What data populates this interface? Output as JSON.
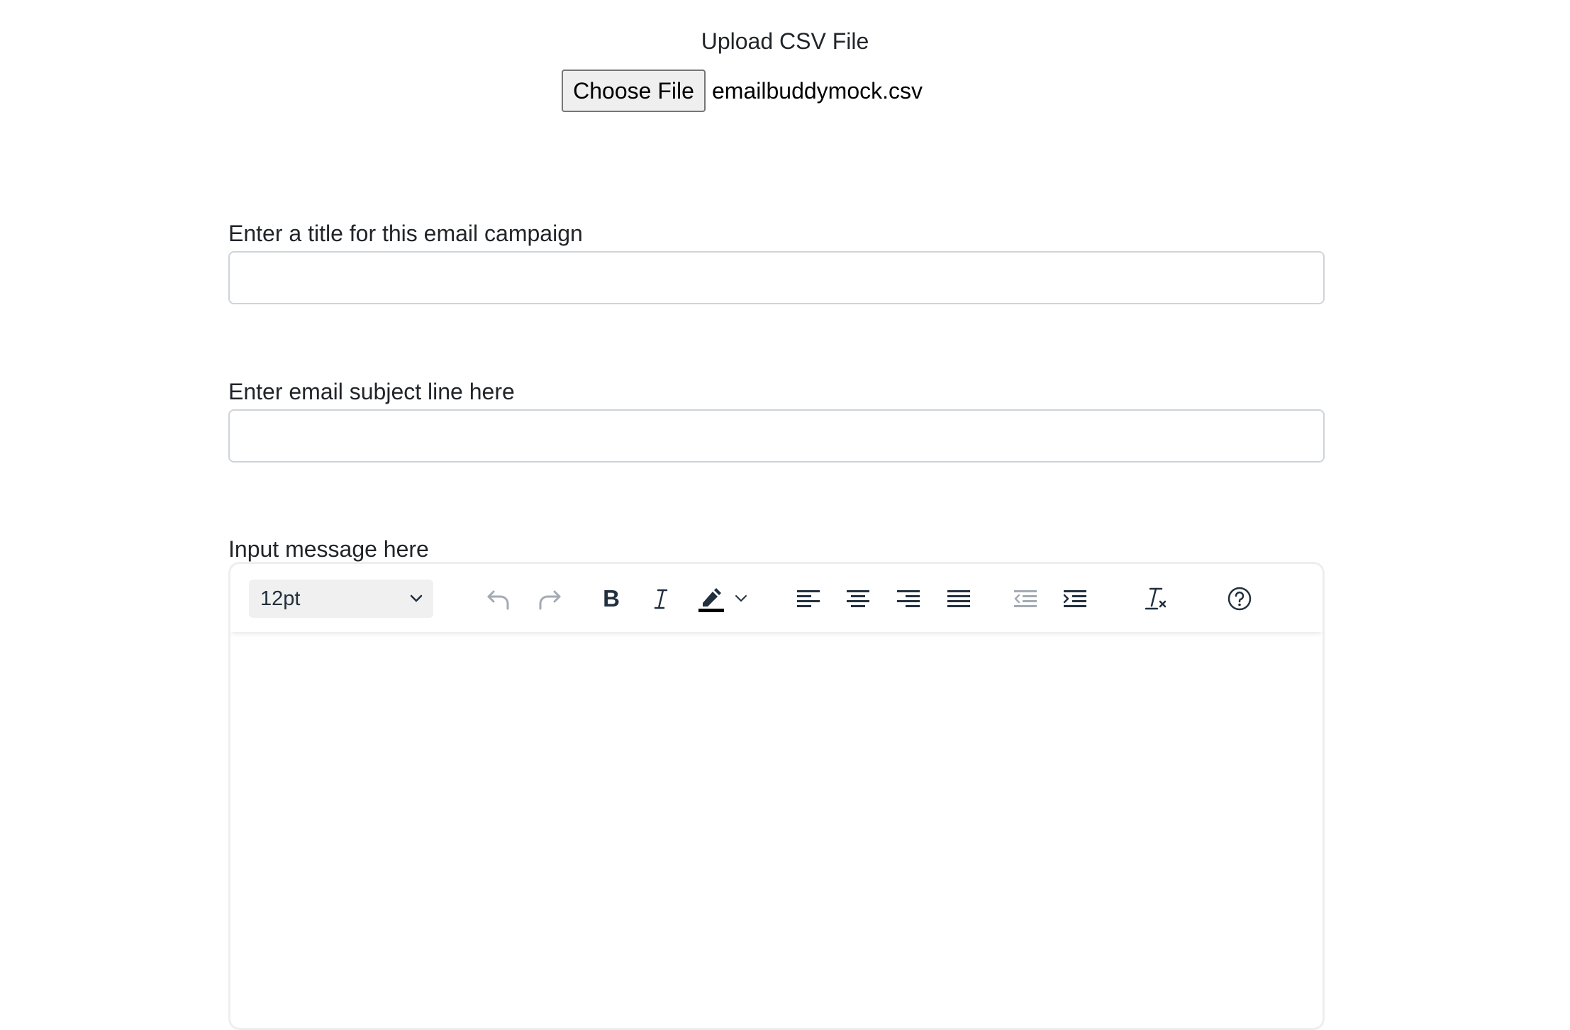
{
  "upload": {
    "title": "Upload CSV File",
    "choose_label": "Choose File",
    "file_name": "emailbuddymock.csv"
  },
  "campaign_title": {
    "label": "Enter a title for this email campaign",
    "value": ""
  },
  "subject": {
    "label": "Enter email subject line here",
    "value": ""
  },
  "message": {
    "label": "Input message here",
    "font_size": "12pt",
    "toolbar_icons": [
      "undo-icon",
      "redo-icon",
      "bold-icon",
      "italic-icon",
      "highlight-icon",
      "chevron-down-icon",
      "align-left-icon",
      "align-center-icon",
      "align-right-icon",
      "align-justify-icon",
      "outdent-icon",
      "indent-icon",
      "clear-formatting-icon",
      "help-icon"
    ],
    "body": ""
  },
  "colors": {
    "text": "#212529",
    "icon": "#222f3e",
    "disabled_icon": "#a3aab3",
    "border": "#ced4da"
  }
}
